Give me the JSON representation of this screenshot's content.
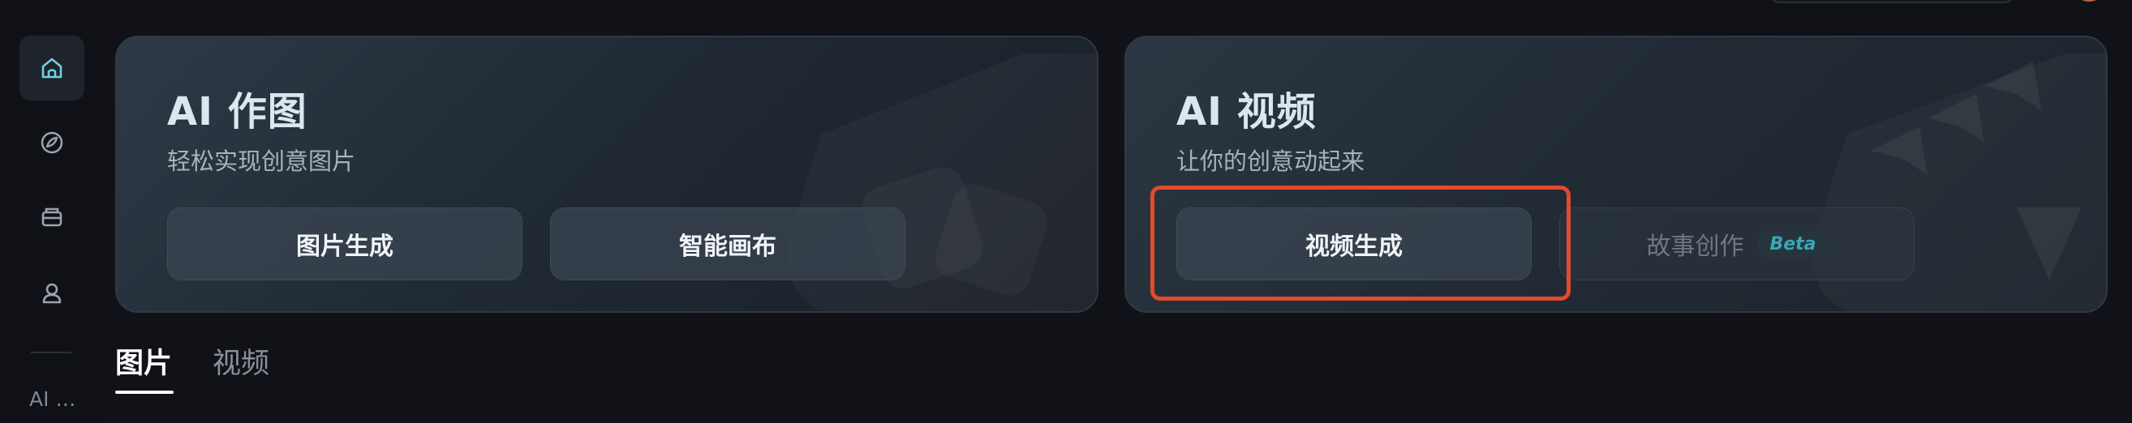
{
  "sidebar": {
    "items": [
      {
        "name": "home",
        "icon": "home-icon",
        "active": true
      },
      {
        "name": "explore",
        "icon": "compass-icon",
        "active": false
      },
      {
        "name": "assets",
        "icon": "box-icon",
        "active": false
      },
      {
        "name": "profile",
        "icon": "user-icon",
        "active": false
      }
    ],
    "footer_label": "AI …"
  },
  "cards": {
    "image": {
      "title": "AI 作图",
      "subtitle": "轻松实现创意图片",
      "buttons": [
        "图片生成",
        "智能画布"
      ]
    },
    "video": {
      "title": "AI 视频",
      "subtitle": "让你的创意动起来",
      "buttons": [
        "视频生成",
        "故事创作"
      ],
      "beta_label": "Beta"
    }
  },
  "tabs": {
    "items": [
      "图片",
      "视频"
    ],
    "active": "图片"
  },
  "colors": {
    "background": "#101217",
    "accent": "#6fd0e0",
    "highlight": "#e24a2f",
    "beta_text": "#3aa6b6"
  }
}
